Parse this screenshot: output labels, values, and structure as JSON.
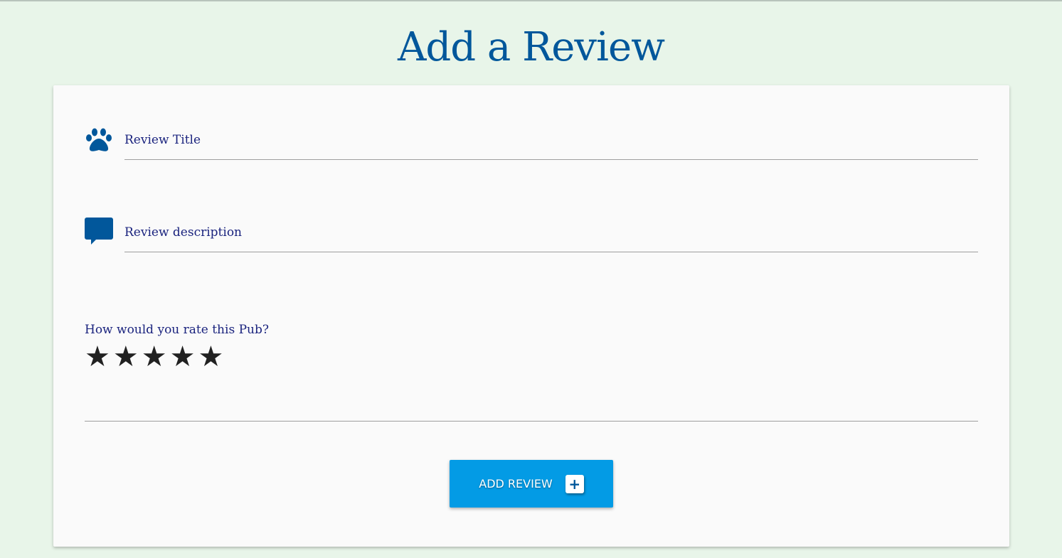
{
  "page": {
    "title": "Add a Review"
  },
  "form": {
    "title_placeholder": "Review Title",
    "description_placeholder": "Review description",
    "rating_label": "How would you rate this Pub?",
    "stars": [
      "★",
      "★",
      "★",
      "★",
      "★"
    ],
    "submit_label": "ADD REVIEW",
    "submit_icon": "+"
  },
  "colors": {
    "accent": "#01579b",
    "button": "#039be5",
    "background": "#e8f5e9"
  }
}
